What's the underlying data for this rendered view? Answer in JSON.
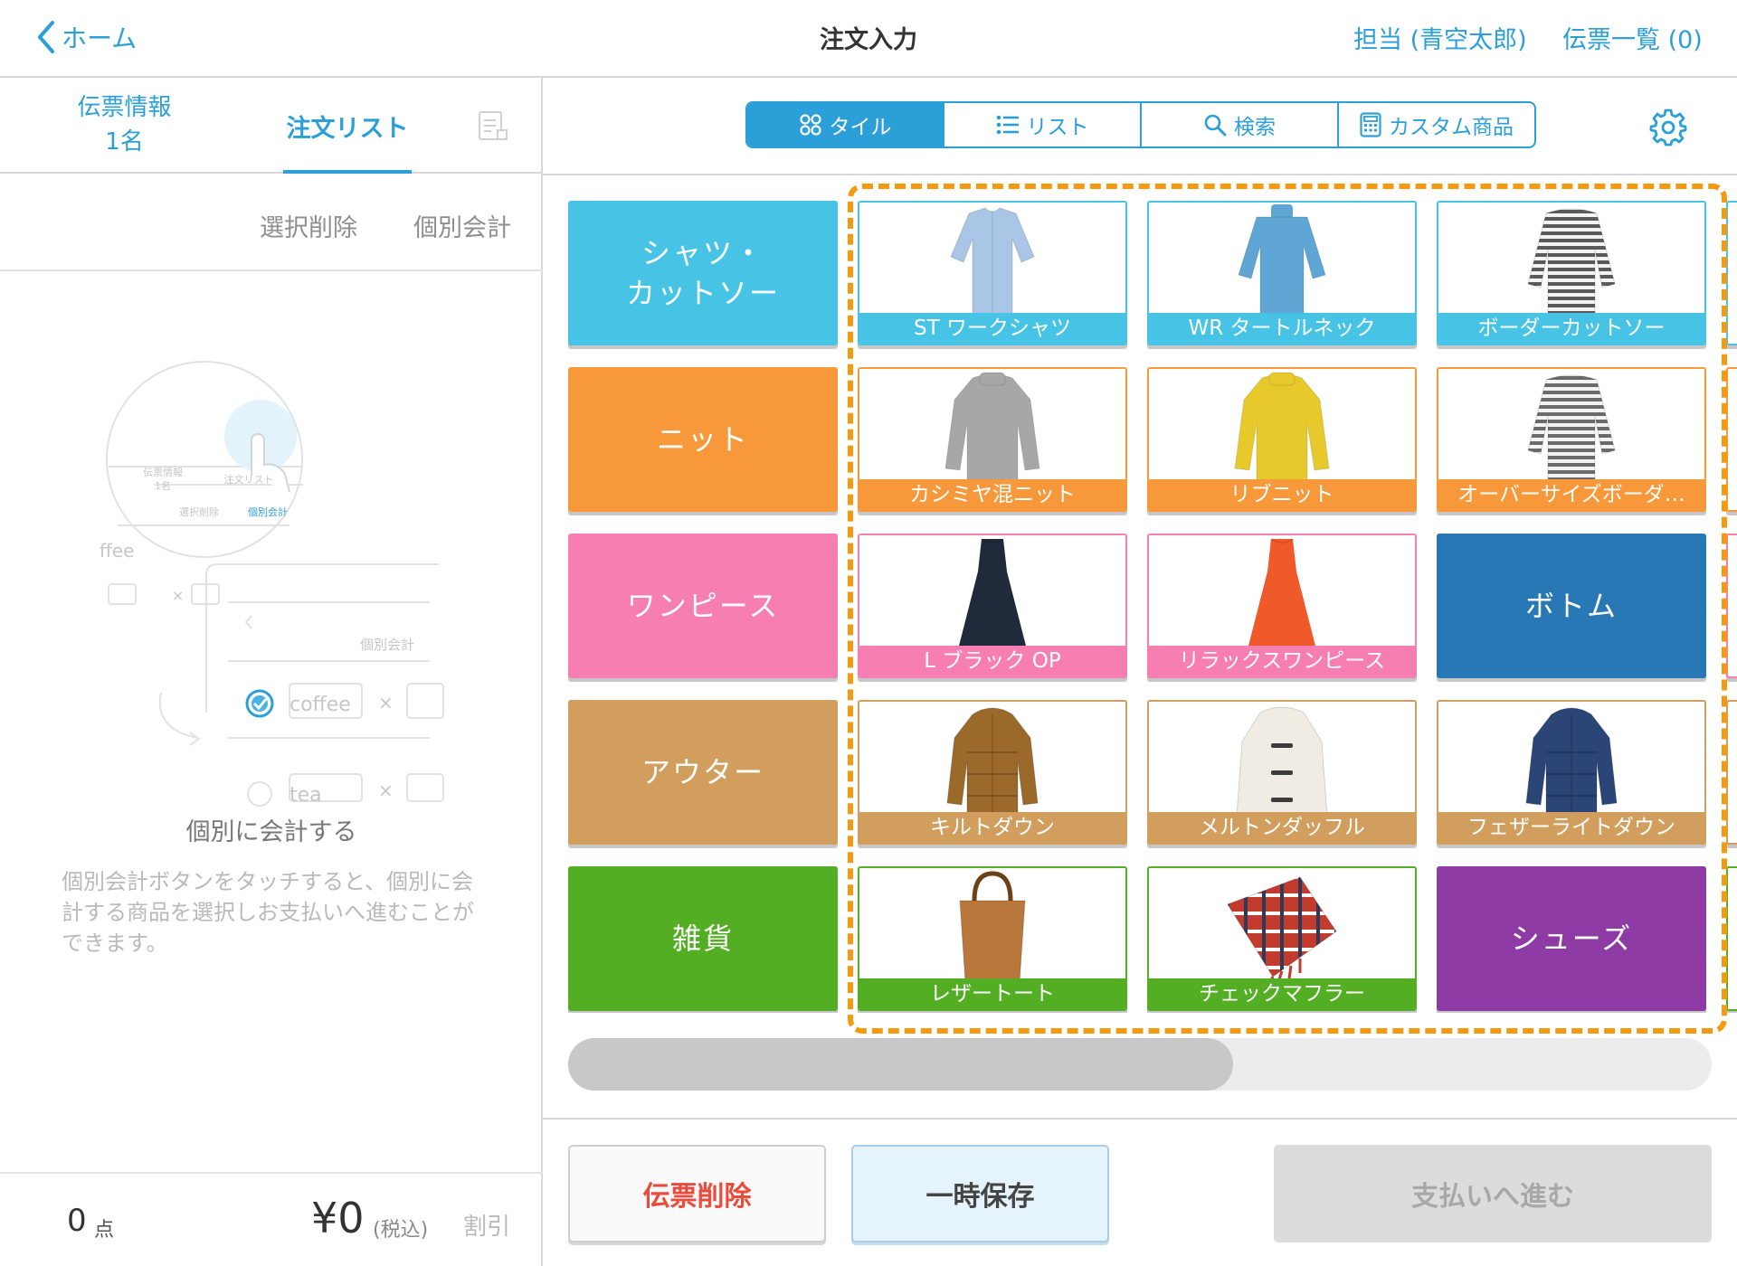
{
  "header": {
    "back_label": "ホーム",
    "title": "注文入力",
    "staff_label": "担当 (青空太郎)",
    "slip_list_label": "伝票一覧 (0)"
  },
  "left_panel": {
    "tab_info_line1": "伝票情報",
    "tab_info_line2": "1名",
    "tab_order": "注文リスト",
    "action_delete": "選択削除",
    "action_split": "個別会計",
    "illustration": {
      "tab_info_line1": "伝票情報",
      "tab_info_line2": "1名",
      "tab_order": "注文リスト",
      "action_delete": "選択削除",
      "action_split": "個別会計",
      "item_partial": "ffee",
      "detail_split": "個別会計",
      "item_coffee": "coffee",
      "item_tea": "tea",
      "times": "×"
    },
    "empty_title": "個別に会計する",
    "empty_description": "個別会計ボタンをタッチすると、個別に会計する商品を選択しお支払いへ進むことができます。",
    "footer": {
      "count_value": "0",
      "count_unit": "点",
      "total": "¥0",
      "tax_note": "(税込)",
      "discount_label": "割引"
    }
  },
  "view_modes": [
    {
      "label": "タイル",
      "icon": "tile-grid-icon",
      "active": true
    },
    {
      "label": "リスト",
      "icon": "list-icon",
      "active": false
    },
    {
      "label": "検索",
      "icon": "search-icon",
      "active": false
    },
    {
      "label": "カスタム商品",
      "icon": "calculator-icon",
      "active": false
    }
  ],
  "categories": [
    {
      "label": "シャツ・\nカットソー",
      "color": "#47c4e5"
    },
    {
      "label": "ニット",
      "color": "#f7983b"
    },
    {
      "label": "ワンピース",
      "color": "#f77eb0"
    },
    {
      "label": "アウター",
      "color": "#d19e5d"
    },
    {
      "label": "雑貨",
      "color": "#53ae23"
    }
  ],
  "product_rows": [
    [
      {
        "label": "ST ワークシャツ",
        "icon": "shirt-icon",
        "garment_color": "#a9c6e6"
      },
      {
        "label": "WR タートルネック",
        "icon": "turtleneck-icon",
        "garment_color": "#5fa6d4"
      },
      {
        "label": "ボーダーカットソー",
        "icon": "striped-top-icon",
        "garment_color": "#5a5a5a"
      }
    ],
    [
      {
        "label": "カシミヤ混ニット",
        "icon": "sweater-icon",
        "garment_color": "#a7a7a7"
      },
      {
        "label": "リブニット",
        "icon": "sweater-icon",
        "garment_color": "#e8c92b"
      },
      {
        "label": "オーバーサイズボーダ…",
        "icon": "striped-top-icon",
        "garment_color": "#6a6a6a"
      }
    ],
    [
      {
        "label": "L ブラック OP",
        "icon": "dress-icon",
        "garment_color": "#1f2a3a"
      },
      {
        "label": "リラックスワンピース",
        "icon": "dress-icon",
        "garment_color": "#f0592a"
      },
      {
        "label": "ボトム",
        "is_category": true,
        "color": "#2778b4"
      }
    ],
    [
      {
        "label": "キルトダウン",
        "icon": "down-jacket-icon",
        "garment_color": "#9b6a2a"
      },
      {
        "label": "メルトンダッフル",
        "icon": "duffle-coat-icon",
        "garment_color": "#f1ece3"
      },
      {
        "label": "フェザーライトダウン",
        "icon": "down-jacket-icon",
        "garment_color": "#2c4577"
      }
    ],
    [
      {
        "label": "レザートート",
        "icon": "tote-bag-icon",
        "garment_color": "#b9773c"
      },
      {
        "label": "チェックマフラー",
        "icon": "scarf-icon",
        "garment_color": "#c33b2c"
      },
      {
        "label": "シューズ",
        "is_category": true,
        "color": "#8e3ba6"
      }
    ]
  ],
  "bottom_buttons": {
    "delete_slip": "伝票削除",
    "hold": "一時保存",
    "pay": "支払いへ進む"
  },
  "colors": {
    "accent": "#2a9fd8",
    "highlight_dash": "#f59a0e",
    "delete_text": "#e94b3c"
  }
}
